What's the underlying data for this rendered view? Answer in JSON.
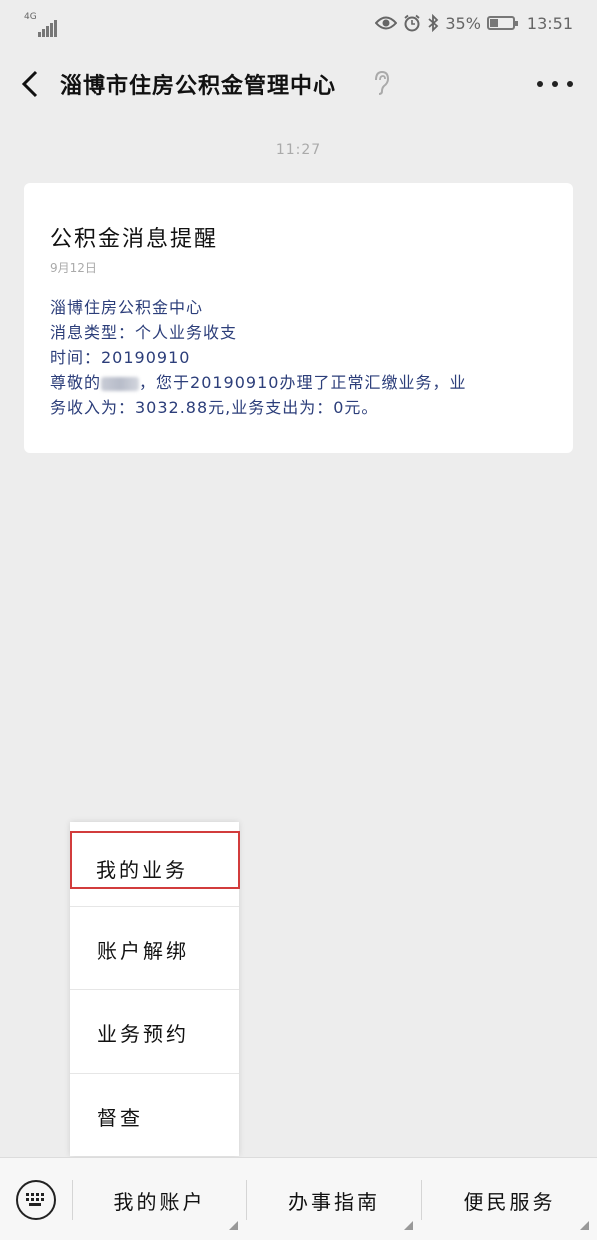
{
  "status_bar": {
    "network": "4G",
    "battery": "35%",
    "battery_level": 0.35,
    "clock": "13:51",
    "icons": [
      "eye-icon",
      "alarm-icon",
      "bluetooth-icon"
    ]
  },
  "header": {
    "title": "淄博市住房公积金管理中心",
    "back_icon": "chevron-left-icon",
    "ear_icon": "ear-icon",
    "more_icon": "more-horizontal-icon"
  },
  "chat": {
    "time": "11:27"
  },
  "message": {
    "title": "公积金消息提醒",
    "date": "9月12日",
    "lines": [
      "淄博住房公积金中心",
      "消息类型：个人业务收支",
      "时间：20190910"
    ],
    "line4_prefix": "尊敬的",
    "line4_suffix": "，您于20190910办理了正常汇缴业务，业",
    "line5": "务收入为：3032.88元,业务支出为：0元。"
  },
  "popup_menu": {
    "items": [
      {
        "label": "我的业务",
        "highlighted": true
      },
      {
        "label": "账户解绑"
      },
      {
        "label": "业务预约"
      },
      {
        "label": "督查"
      }
    ],
    "highlight_color": "#d23c3c"
  },
  "bottom_menu": {
    "keyboard_icon": "keyboard-icon",
    "tabs": [
      {
        "label": "我的账户"
      },
      {
        "label": "办事指南"
      },
      {
        "label": "便民服务"
      }
    ]
  }
}
